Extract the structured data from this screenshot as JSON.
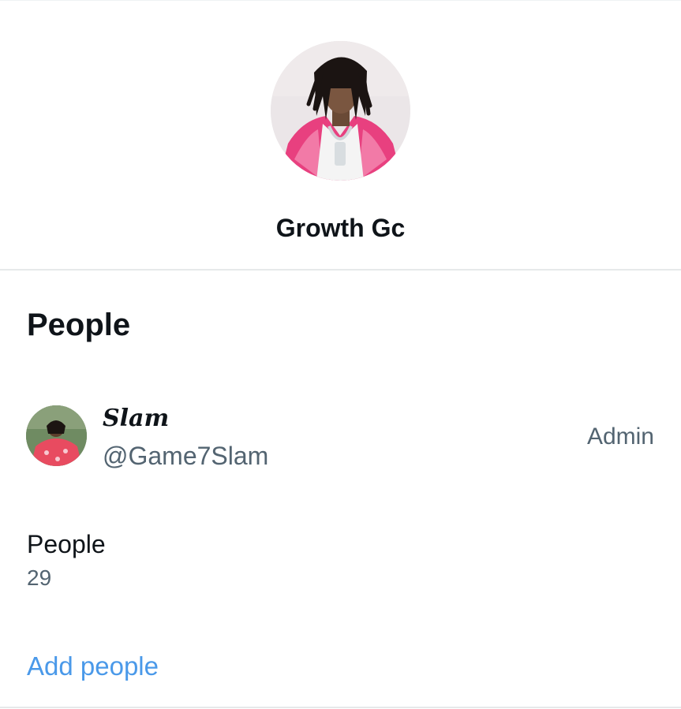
{
  "group": {
    "name": "Growth Gc",
    "avatar_icon": "group-avatar-photo"
  },
  "people_section": {
    "title": "People",
    "members": [
      {
        "display_name": "Slam",
        "handle": "@Game7Slam",
        "role": "Admin",
        "avatar_icon": "user-avatar-photo"
      }
    ],
    "count_label": "People",
    "count_value": "29",
    "add_label": "Add people"
  },
  "colors": {
    "text_primary": "#0f1419",
    "text_secondary": "#536471",
    "link": "#4a99e9",
    "divider": "#e6e9ea"
  }
}
